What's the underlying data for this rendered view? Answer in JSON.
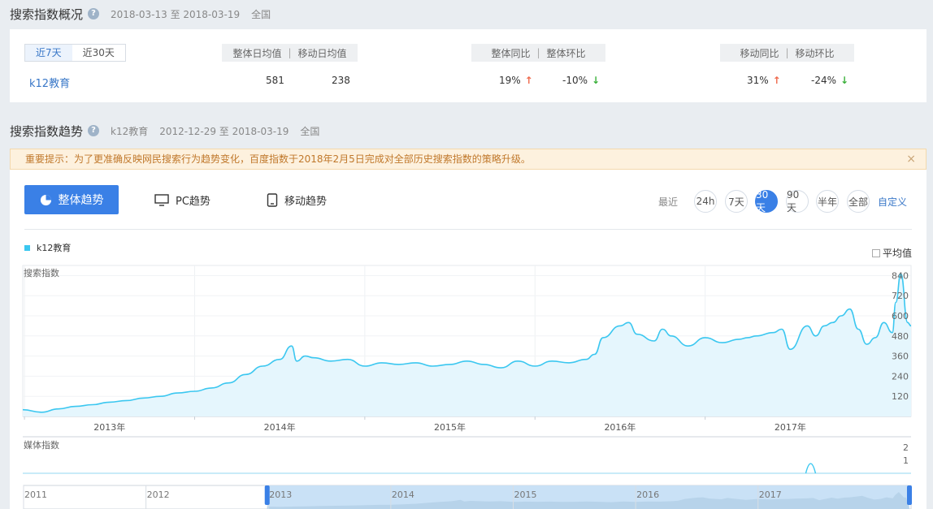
{
  "overview": {
    "title": "搜索指数概况",
    "date_range": "2018-03-13 至 2018-03-19",
    "region": "全国",
    "toggle": [
      "近7天",
      "近30天"
    ],
    "keyword": "k12教育",
    "label_daily_overall": "整体日均值",
    "label_daily_mobile": "移动日均值",
    "label_yoy_overall": "整体同比",
    "label_qoq_overall": "整体环比",
    "label_yoy_mobile": "移动同比",
    "label_qoq_mobile": "移动环比",
    "separator": "|",
    "overall_avg": "581",
    "mobile_avg": "238",
    "overall_yoy": "19%",
    "overall_qoq": "-10%",
    "mobile_yoy": "31%",
    "mobile_qoq": "-24%",
    "arrow_up": "↑",
    "arrow_down": "↓"
  },
  "trend": {
    "title": "搜索指数趋势",
    "keyword": "k12教育",
    "date_range": "2012-12-29 至 2018-03-19",
    "region": "全国",
    "notice": "重要提示：为了更准确反映网民搜索行为趋势变化，百度指数于2018年2月5日完成对全部历史搜索指数的策略升级。",
    "close_glyph": "×",
    "tab_overall": "整体趋势",
    "tab_pc": "PC趋势",
    "tab_mobile": "移动趋势",
    "range_label": "最近",
    "ranges": [
      "24h",
      "7天",
      "30天",
      "90天",
      "半年",
      "全部"
    ],
    "active_range": "30天",
    "custom": "自定义",
    "legend": "k12教育",
    "avg_label": "平均值",
    "search_label": "搜索指数",
    "media_label": "媒体指数"
  },
  "colors": {
    "line": "#3bc7f0",
    "fill": "#e5f6fd",
    "accent": "#3a80e6",
    "up": "#ef6a4d",
    "down": "#3ab03a"
  },
  "chart_data": {
    "type": "area",
    "x_ticks": [
      "2013年",
      "2014年",
      "2015年",
      "2016年",
      "2017年"
    ],
    "y_ticks": [
      120,
      240,
      360,
      480,
      600,
      720,
      840
    ],
    "ylim": [
      0,
      900
    ],
    "xlim": [
      2012.99,
      2018.21
    ],
    "series": [
      {
        "name": "k12教育",
        "x": [
          2012.99,
          2013.1,
          2013.2,
          2013.3,
          2013.4,
          2013.5,
          2013.6,
          2013.7,
          2013.8,
          2013.9,
          2014.0,
          2014.1,
          2014.2,
          2014.3,
          2014.4,
          2014.5,
          2014.57,
          2014.6,
          2014.65,
          2014.7,
          2014.8,
          2014.9,
          2015.0,
          2015.1,
          2015.2,
          2015.3,
          2015.4,
          2015.5,
          2015.6,
          2015.7,
          2015.8,
          2015.9,
          2016.0,
          2016.1,
          2016.2,
          2016.3,
          2016.35,
          2016.4,
          2016.5,
          2016.55,
          2016.6,
          2016.7,
          2016.75,
          2016.8,
          2016.9,
          2017.0,
          2017.1,
          2017.2,
          2017.25,
          2017.3,
          2017.4,
          2017.45,
          2017.5,
          2017.6,
          2017.65,
          2017.7,
          2017.75,
          2017.8,
          2017.85,
          2017.9,
          2017.95,
          2018.0,
          2018.05,
          2018.1,
          2018.12,
          2018.15,
          2018.19,
          2018.21
        ],
        "values": [
          40,
          25,
          45,
          60,
          70,
          85,
          95,
          110,
          120,
          140,
          150,
          170,
          200,
          250,
          300,
          340,
          420,
          330,
          360,
          350,
          330,
          340,
          300,
          320,
          310,
          320,
          300,
          310,
          330,
          310,
          290,
          330,
          300,
          330,
          320,
          340,
          370,
          470,
          540,
          560,
          490,
          450,
          520,
          480,
          420,
          470,
          440,
          460,
          470,
          480,
          500,
          520,
          400,
          540,
          480,
          540,
          560,
          600,
          640,
          520,
          430,
          470,
          560,
          500,
          680,
          850,
          560,
          540
        ]
      }
    ],
    "media_ticks": [
      1,
      2
    ],
    "media_values_peak": 1,
    "navigator_ticks": [
      "2011",
      "2012",
      "2013",
      "2014",
      "2015",
      "2016",
      "2017"
    ]
  }
}
